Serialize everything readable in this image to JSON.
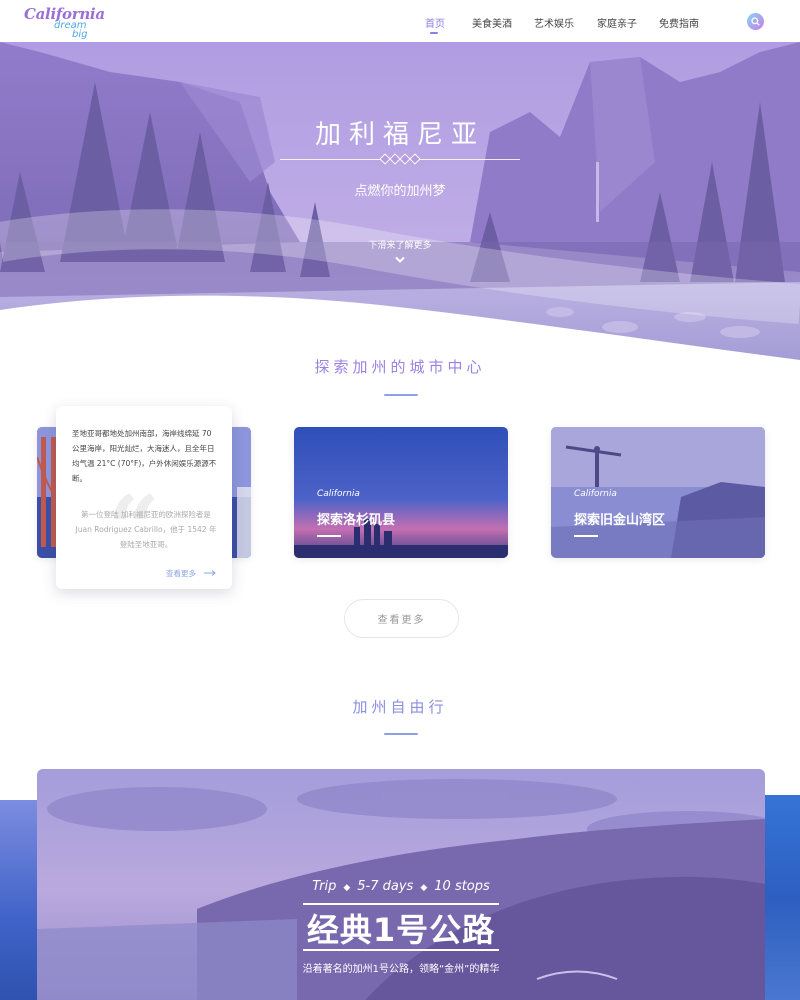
{
  "brand": {
    "logo_main": "California",
    "logo_line2": "dream",
    "logo_line3": "big"
  },
  "nav": {
    "items": [
      {
        "label": "首页",
        "active": true
      },
      {
        "label": "美食美酒",
        "active": false
      },
      {
        "label": "艺术娱乐",
        "active": false
      },
      {
        "label": "家庭亲子",
        "active": false
      },
      {
        "label": "免费指南",
        "active": false
      }
    ],
    "search_icon": "search-icon"
  },
  "hero": {
    "title": "加利福尼亚",
    "subtitle": "点燃你的加州梦",
    "scroll_hint": "下滑来了解更多"
  },
  "cities_section": {
    "title": "探索加州的城市中心",
    "popup": {
      "paragraph1": "圣地亚哥都地处加州南部，海岸线绵延 70 公里海岸，阳光灿烂，大海迷人，且全年日均气温 21°C (70°F)，户外休闲娱乐源源不断。",
      "paragraph2": "第一位登陆 加利福尼亚的欧洲探险者是 Juan Rodriguez Cabrillo，他于 1542 年登陆圣地亚哥。",
      "more_link": "查看更多"
    },
    "cards": [
      {
        "tag": "California",
        "name": "探索洛杉矶县"
      },
      {
        "tag": "California",
        "name": "探索旧金山湾区"
      }
    ],
    "more_button": "查看更多"
  },
  "trip_section": {
    "title": "加州自由行",
    "card": {
      "meta_trip": "Trip",
      "meta_days": "5-7 days",
      "meta_stops": "10 stops",
      "title": "经典1号公路",
      "description": "沿着著名的加州1号公路，领略“金州”的精华"
    }
  },
  "colors": {
    "accent": "#9b82e0",
    "accent_blue": "#8ea0e8",
    "hero_overlay": "#9a86d8"
  }
}
